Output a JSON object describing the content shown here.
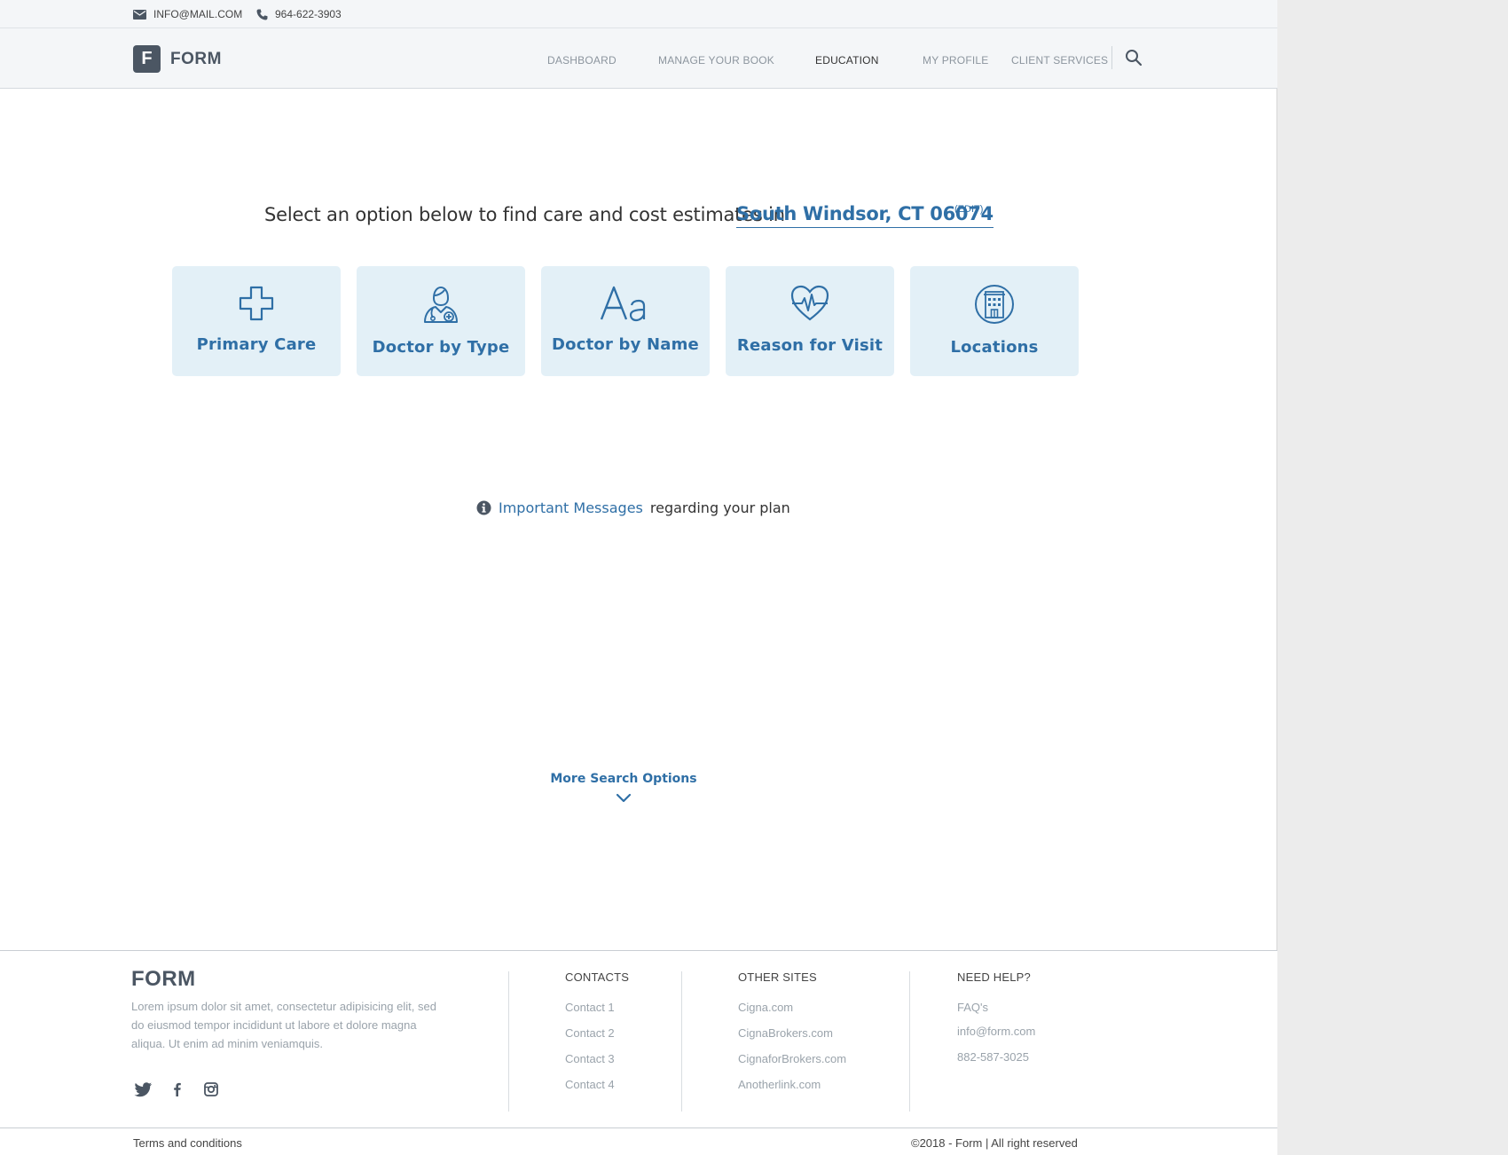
{
  "topbar": {
    "email": "INFO@MAIL.COM",
    "phone": "964-622-3903",
    "email_icon": "mail-icon",
    "phone_icon": "phone-icon"
  },
  "header": {
    "logo_letter": "F",
    "logo_text": "FORM",
    "nav": [
      {
        "label": "DASHBOARD",
        "active": false
      },
      {
        "label": "MANAGE YOUR BOOK",
        "active": false
      },
      {
        "label": "EDUCATION",
        "active": true
      },
      {
        "label": "MY PROFILE",
        "active": false
      },
      {
        "label": "CLIENT SERVICES",
        "active": false
      }
    ],
    "search_icon": "search-icon"
  },
  "hero": {
    "headline": "Select an option below to find care and cost estimates in",
    "location": "South Windsor, CT 06074",
    "edit_label": "(EDIT)"
  },
  "cards": [
    {
      "label": "Primary Care",
      "icon": "medical-cross-icon"
    },
    {
      "label": "Doctor by Type",
      "icon": "doctor-icon"
    },
    {
      "label": "Doctor by Name",
      "icon": "letters-icon"
    },
    {
      "label": "Reason for Visit",
      "icon": "heartbeat-icon"
    },
    {
      "label": "Locations",
      "icon": "building-icon"
    }
  ],
  "messages": {
    "link": "Important Messages",
    "rest": "regarding your plan",
    "icon": "info-icon"
  },
  "more_options": {
    "label": "More Search Options",
    "icon": "chevron-down-icon"
  },
  "footer": {
    "brand": "FORM",
    "description": "Lorem ipsum dolor sit amet, consectetur adipisicing elit, sed do eiusmod tempor incididunt ut labore et dolore magna aliqua. Ut enim ad minim veniamquis.",
    "social": [
      "twitter-icon",
      "facebook-icon",
      "instagram-icon"
    ],
    "contacts": {
      "title": "CONTACTS",
      "links": [
        "Contact 1",
        "Contact 2",
        "Contact 3",
        "Contact 4"
      ]
    },
    "other_sites": {
      "title": "OTHER SITES",
      "links": [
        "Cigna.com",
        "CignaBrokers.com",
        "CignaforBrokers.com",
        "Anotherlink.com"
      ]
    },
    "need_help": {
      "title": "NEED HELP?",
      "links": [
        "FAQ's",
        "info@form.com",
        "882-587-3025"
      ]
    },
    "terms": "Terms and conditions",
    "copyright": "©2018 - Form  |   All right reserved"
  },
  "colors": {
    "accent": "#2f6fa6",
    "card_bg": "#e3f0f7",
    "logo_bg": "#4b5663",
    "header_bg": "#f4f6f8"
  }
}
